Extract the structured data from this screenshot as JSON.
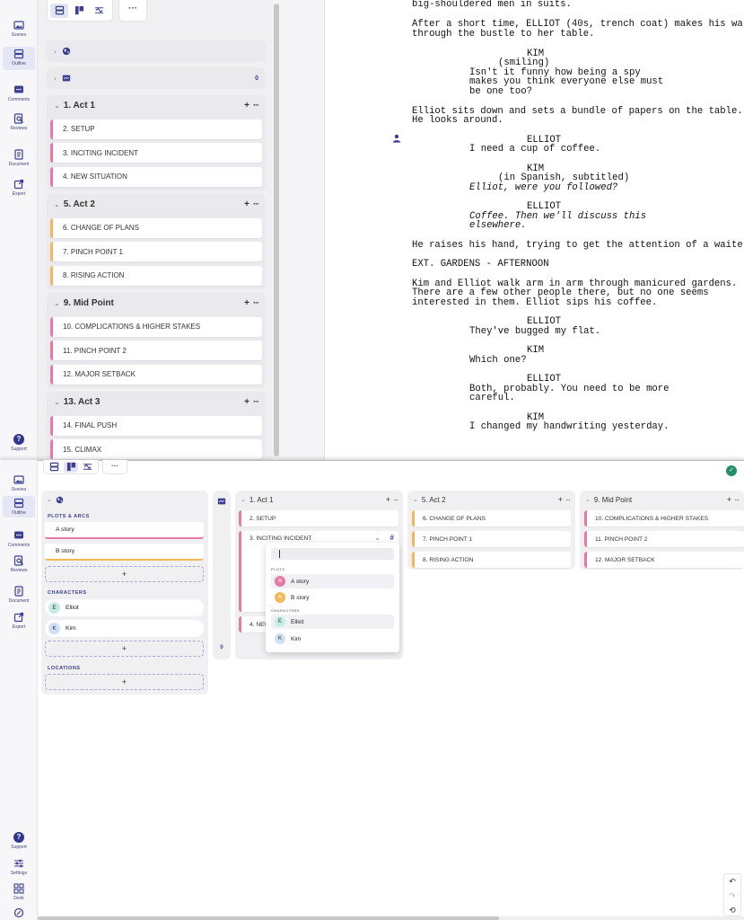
{
  "rail_top": [
    {
      "label": "Scenes",
      "icon": "image-icon"
    },
    {
      "label": "Outline",
      "icon": "outline-icon",
      "active": true
    },
    {
      "label": "Comments",
      "icon": "comment-icon"
    },
    {
      "label": "Reviews",
      "icon": "review-icon"
    },
    {
      "label": "Document",
      "icon": "document-icon"
    },
    {
      "label": "Export",
      "icon": "export-icon"
    }
  ],
  "rail_support": "Support",
  "rail_bottom_extra": [
    "Settings",
    "Desk"
  ],
  "toolbar_more": "···",
  "outline": {
    "world_row_count": "",
    "images_row_count": "0",
    "acts": [
      {
        "title": "1. Act 1",
        "cards": [
          {
            "label": "2. SETUP",
            "color": "pink"
          },
          {
            "label": "3. INCITING INCIDENT",
            "color": "pink"
          },
          {
            "label": "4. NEW SITUATION",
            "color": "pink"
          }
        ]
      },
      {
        "title": "5. Act 2",
        "cards": [
          {
            "label": "6. CHANGE OF PLANS",
            "color": "orange"
          },
          {
            "label": "7. PINCH POINT 1",
            "color": "orange"
          },
          {
            "label": "8. RISING ACTION",
            "color": "orange"
          }
        ]
      },
      {
        "title": "9. Mid Point",
        "cards": [
          {
            "label": "10. COMPLICATIONS & HIGHER STAKES",
            "color": "pink"
          },
          {
            "label": "11. PINCH POINT 2",
            "color": "pink"
          },
          {
            "label": "12. MAJOR SETBACK",
            "color": "pink"
          }
        ]
      },
      {
        "title": "13. Act 3",
        "cards": [
          {
            "label": "14. FINAL PUSH",
            "color": "pink"
          },
          {
            "label": "15. CLIMAX",
            "color": "pink"
          }
        ]
      }
    ]
  },
  "script": {
    "l01": "big-shouldered men in suits.",
    "l02": "After a short time, ELLIOT (40s, trench coat) makes his wa",
    "l03": "through the bustle to her table.",
    "l04": "KIM",
    "l05": "(smiling)",
    "l06": "Isn't it funny how being a spy",
    "l07": "makes you think everyone else must",
    "l08": "be one too?",
    "l09": "Elliot sits down and sets a bundle of papers on the table.",
    "l10": "He looks around.",
    "l11": "ELLIOT",
    "l12": "I need a cup of coffee.",
    "l13": "KIM",
    "l14": "(in Spanish, subtitled)",
    "l15": "Elliot, were you followed?",
    "l16": "ELLIOT",
    "l17": "Coffee. Then we'll discuss this",
    "l18": "elsewhere.",
    "l19": "He raises his hand, trying to get the attention of a waite",
    "l20": "EXT. GARDENS - AFTERNOON",
    "l21": "Kim and Elliot walk arm in arm through manicured gardens.",
    "l22": "There are a few other people there, but no one seems",
    "l23": "interested in them. Elliot sips his coffee.",
    "l24": "ELLIOT",
    "l25": "They've bugged my flat.",
    "l26": "KIM",
    "l27": "Which one?",
    "l28": "ELLIOT",
    "l29": "Both, probably. You need to be more",
    "l30": "careful.",
    "l31": "KIM",
    "l32": "I changed my handwriting yesterday."
  },
  "board": {
    "plots_label": "PLOTS & ARCS",
    "plots": [
      "A story",
      "B story"
    ],
    "characters_label": "CHARACTERS",
    "characters": [
      {
        "name": "Elliot",
        "initial": "E"
      },
      {
        "name": "Kim",
        "initial": "K"
      }
    ],
    "locations_label": "LOCATIONS",
    "add": "+",
    "images_count": "0",
    "col1_title": "1. Act 1",
    "col1_cards": [
      "2. SETUP",
      "3. INCITING INCIDENT",
      "4. NEW"
    ],
    "col1_tag": "#",
    "col2_title": "5. Act 2",
    "col2_cards": [
      "6. CHANGE OF PLANS",
      "7. PINCH POINT 1",
      "8. RISING ACTION"
    ],
    "col3_title": "9. Mid Point",
    "col3_cards": [
      "10. COMPLICATIONS & HIGHER STAKES",
      "11. PINCH POINT 2",
      "12. MAJOR SETBACK"
    ]
  },
  "popup": {
    "plots_label": "PLOTS",
    "plots": [
      "A story",
      "B story"
    ],
    "characters_label": "CHARACTERS",
    "characters": [
      {
        "name": "Elliot",
        "initial": "E"
      },
      {
        "name": "Kim",
        "initial": "K"
      }
    ]
  },
  "corner": {
    "undo": "↶",
    "redo": "↷",
    "history": "⟲"
  },
  "status_ok": "✓",
  "colors": {
    "accent": "#3b3f8e",
    "pink": "#e87aa1",
    "orange": "#f4b85a",
    "ok": "#1f8f6a"
  }
}
